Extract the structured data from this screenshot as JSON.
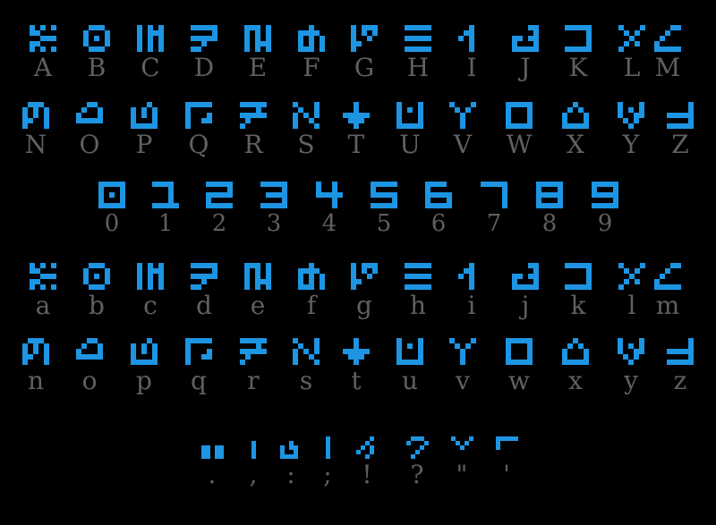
{
  "colors": {
    "background": "#000000",
    "glyph": "#1d95e3",
    "label": "#606060"
  },
  "rows": [
    {
      "name": "uppercase-a-m",
      "cells": [
        "A",
        "B",
        "C",
        "D",
        "E",
        "F",
        "G",
        "H",
        "I",
        "J",
        "K",
        "L",
        "M"
      ]
    },
    {
      "name": "uppercase-n-z",
      "cells": [
        "N",
        "O",
        "P",
        "Q",
        "R",
        "S",
        "T",
        "U",
        "V",
        "W",
        "X",
        "Y",
        "Z"
      ]
    },
    {
      "name": "digits",
      "cells": [
        "0",
        "1",
        "2",
        "3",
        "4",
        "5",
        "6",
        "7",
        "8",
        "9"
      ]
    },
    {
      "name": "lowercase-a-m",
      "cells": [
        "a",
        "b",
        "c",
        "d",
        "e",
        "f",
        "g",
        "h",
        "i",
        "j",
        "k",
        "l",
        "m"
      ]
    },
    {
      "name": "lowercase-n-z",
      "cells": [
        "n",
        "o",
        "p",
        "q",
        "r",
        "s",
        "t",
        "u",
        "v",
        "w",
        "x",
        "y",
        "z"
      ]
    },
    {
      "name": "punctuation",
      "cells": [
        ".",
        ",",
        ":",
        ";",
        "!",
        "?",
        "\"",
        "'"
      ]
    }
  ]
}
